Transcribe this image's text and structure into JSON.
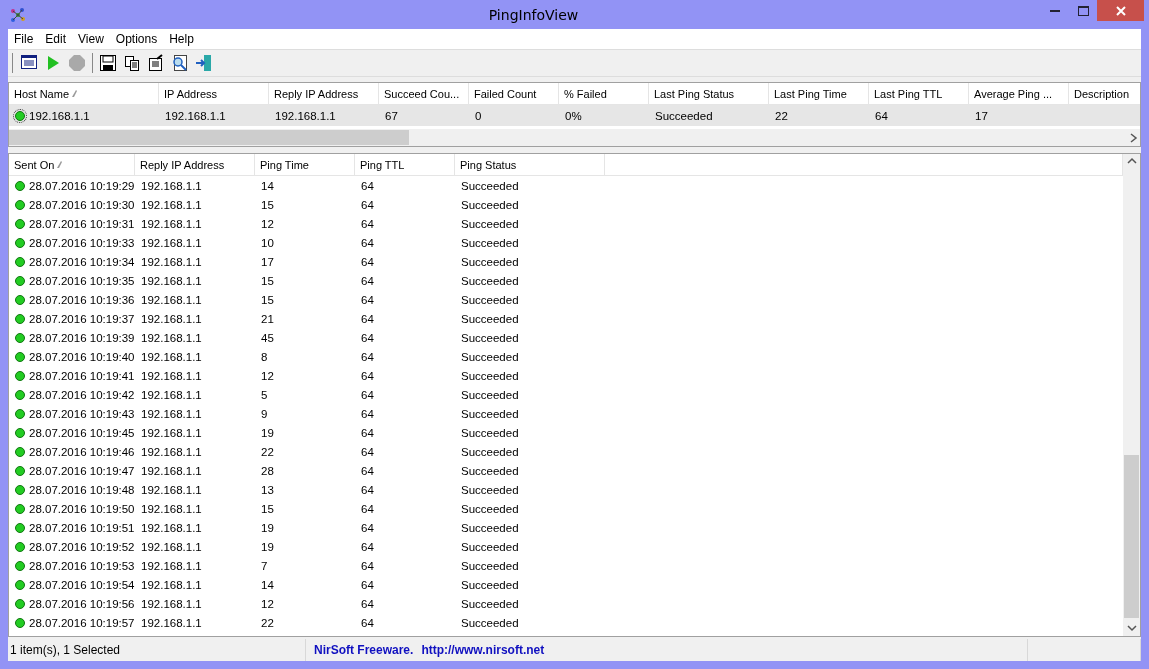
{
  "window": {
    "title": "PingInfoView"
  },
  "menu": [
    "File",
    "Edit",
    "View",
    "Options",
    "Help"
  ],
  "toolbar": [
    {
      "kind": "report",
      "disabled": false
    },
    {
      "kind": "play",
      "disabled": false
    },
    {
      "kind": "stop",
      "disabled": true
    },
    {
      "kind": "separator"
    },
    {
      "kind": "save",
      "disabled": false
    },
    {
      "kind": "copy",
      "disabled": false
    },
    {
      "kind": "properties",
      "disabled": false
    },
    {
      "kind": "find",
      "disabled": false
    },
    {
      "kind": "exit",
      "disabled": false
    }
  ],
  "hosts_table": {
    "columns": [
      {
        "label": "Host Name",
        "sorted": true
      },
      {
        "label": "IP Address",
        "sorted": false
      },
      {
        "label": "Reply IP Address",
        "sorted": false
      },
      {
        "label": "Succeed Cou...",
        "sorted": false
      },
      {
        "label": "Failed Count",
        "sorted": false
      },
      {
        "label": "% Failed",
        "sorted": false
      },
      {
        "label": "Last Ping Status",
        "sorted": false
      },
      {
        "label": "Last Ping Time",
        "sorted": false
      },
      {
        "label": "Last Ping TTL",
        "sorted": false
      },
      {
        "label": "Average Ping ...",
        "sorted": false
      },
      {
        "label": "Description",
        "sorted": false
      }
    ],
    "rows": [
      {
        "cells": [
          "192.168.1.1",
          "192.168.1.1",
          "192.168.1.1",
          "67",
          "0",
          "0%",
          "Succeeded",
          "22",
          "64",
          "17",
          ""
        ],
        "color": "#22cc22",
        "selected": true
      }
    ]
  },
  "pings_table": {
    "columns": [
      {
        "label": "Sent On",
        "sorted": true
      },
      {
        "label": "Reply IP Address",
        "sorted": false
      },
      {
        "label": "Ping Time",
        "sorted": false
      },
      {
        "label": "Ping TTL",
        "sorted": false
      },
      {
        "label": "Ping Status",
        "sorted": false
      }
    ],
    "rows": [
      {
        "cells": [
          "28.07.2016 10:19:29",
          "192.168.1.1",
          "14",
          "64",
          "Succeeded"
        ],
        "color": "#22cc22",
        "selected": false
      },
      {
        "cells": [
          "28.07.2016 10:19:30",
          "192.168.1.1",
          "15",
          "64",
          "Succeeded"
        ],
        "color": "#22cc22",
        "selected": false
      },
      {
        "cells": [
          "28.07.2016 10:19:31",
          "192.168.1.1",
          "12",
          "64",
          "Succeeded"
        ],
        "color": "#22cc22",
        "selected": false
      },
      {
        "cells": [
          "28.07.2016 10:19:33",
          "192.168.1.1",
          "10",
          "64",
          "Succeeded"
        ],
        "color": "#22cc22",
        "selected": false
      },
      {
        "cells": [
          "28.07.2016 10:19:34",
          "192.168.1.1",
          "17",
          "64",
          "Succeeded"
        ],
        "color": "#22cc22",
        "selected": false
      },
      {
        "cells": [
          "28.07.2016 10:19:35",
          "192.168.1.1",
          "15",
          "64",
          "Succeeded"
        ],
        "color": "#22cc22",
        "selected": false
      },
      {
        "cells": [
          "28.07.2016 10:19:36",
          "192.168.1.1",
          "15",
          "64",
          "Succeeded"
        ],
        "color": "#22cc22",
        "selected": false
      },
      {
        "cells": [
          "28.07.2016 10:19:37",
          "192.168.1.1",
          "21",
          "64",
          "Succeeded"
        ],
        "color": "#22cc22",
        "selected": false
      },
      {
        "cells": [
          "28.07.2016 10:19:39",
          "192.168.1.1",
          "45",
          "64",
          "Succeeded"
        ],
        "color": "#22cc22",
        "selected": false
      },
      {
        "cells": [
          "28.07.2016 10:19:40",
          "192.168.1.1",
          "8",
          "64",
          "Succeeded"
        ],
        "color": "#22cc22",
        "selected": false
      },
      {
        "cells": [
          "28.07.2016 10:19:41",
          "192.168.1.1",
          "12",
          "64",
          "Succeeded"
        ],
        "color": "#22cc22",
        "selected": false
      },
      {
        "cells": [
          "28.07.2016 10:19:42",
          "192.168.1.1",
          "5",
          "64",
          "Succeeded"
        ],
        "color": "#22cc22",
        "selected": false
      },
      {
        "cells": [
          "28.07.2016 10:19:43",
          "192.168.1.1",
          "9",
          "64",
          "Succeeded"
        ],
        "color": "#22cc22",
        "selected": false
      },
      {
        "cells": [
          "28.07.2016 10:19:45",
          "192.168.1.1",
          "19",
          "64",
          "Succeeded"
        ],
        "color": "#22cc22",
        "selected": false
      },
      {
        "cells": [
          "28.07.2016 10:19:46",
          "192.168.1.1",
          "22",
          "64",
          "Succeeded"
        ],
        "color": "#22cc22",
        "selected": false
      },
      {
        "cells": [
          "28.07.2016 10:19:47",
          "192.168.1.1",
          "28",
          "64",
          "Succeeded"
        ],
        "color": "#22cc22",
        "selected": false
      },
      {
        "cells": [
          "28.07.2016 10:19:48",
          "192.168.1.1",
          "13",
          "64",
          "Succeeded"
        ],
        "color": "#22cc22",
        "selected": false
      },
      {
        "cells": [
          "28.07.2016 10:19:50",
          "192.168.1.1",
          "15",
          "64",
          "Succeeded"
        ],
        "color": "#22cc22",
        "selected": false
      },
      {
        "cells": [
          "28.07.2016 10:19:51",
          "192.168.1.1",
          "19",
          "64",
          "Succeeded"
        ],
        "color": "#22cc22",
        "selected": false
      },
      {
        "cells": [
          "28.07.2016 10:19:52",
          "192.168.1.1",
          "19",
          "64",
          "Succeeded"
        ],
        "color": "#22cc22",
        "selected": false
      },
      {
        "cells": [
          "28.07.2016 10:19:53",
          "192.168.1.1",
          "7",
          "64",
          "Succeeded"
        ],
        "color": "#22cc22",
        "selected": false
      },
      {
        "cells": [
          "28.07.2016 10:19:54",
          "192.168.1.1",
          "14",
          "64",
          "Succeeded"
        ],
        "color": "#22cc22",
        "selected": false
      },
      {
        "cells": [
          "28.07.2016 10:19:56",
          "192.168.1.1",
          "12",
          "64",
          "Succeeded"
        ],
        "color": "#22cc22",
        "selected": false
      },
      {
        "cells": [
          "28.07.2016 10:19:57",
          "192.168.1.1",
          "22",
          "64",
          "Succeeded"
        ],
        "color": "#22cc22",
        "selected": false
      }
    ]
  },
  "status_bar": {
    "items": "1 item(s), 1 Selected",
    "credit": "NirSoft Freeware.",
    "link": "http://www.nirsoft.net"
  }
}
